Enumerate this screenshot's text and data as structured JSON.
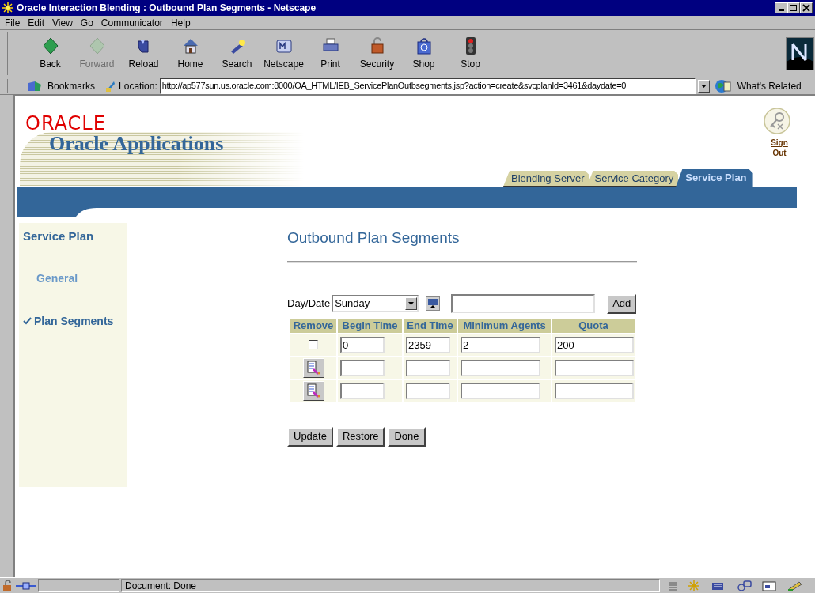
{
  "window": {
    "title": "Oracle Interaction Blending : Outbound Plan Segments - Netscape"
  },
  "menu": [
    "File",
    "Edit",
    "View",
    "Go",
    "Communicator",
    "Help"
  ],
  "toolbar": [
    {
      "label": "Back",
      "kind": "back",
      "disabled": false
    },
    {
      "label": "Forward",
      "kind": "forward",
      "disabled": true
    },
    {
      "label": "Reload",
      "kind": "reload",
      "disabled": false
    },
    {
      "label": "Home",
      "kind": "home",
      "disabled": false
    },
    {
      "label": "Search",
      "kind": "search",
      "disabled": false
    },
    {
      "label": "Netscape",
      "kind": "netscape",
      "disabled": false
    },
    {
      "label": "Print",
      "kind": "print",
      "disabled": false
    },
    {
      "label": "Security",
      "kind": "security",
      "disabled": false
    },
    {
      "label": "Shop",
      "kind": "shop",
      "disabled": false
    },
    {
      "label": "Stop",
      "kind": "stop",
      "disabled": false
    }
  ],
  "location_bar": {
    "bookmarks": "Bookmarks",
    "location_label": "Location:",
    "url": "http://ap577sun.us.oracle.com:8000/OA_HTML/IEB_ServicePlanOutbsegments.jsp?action=create&svcplanId=3461&daydate=0",
    "whats_related": "What's Related"
  },
  "header": {
    "logo": "ORACLE",
    "app_title": "Oracle Applications",
    "sign_out": "Sign Out"
  },
  "tabs": [
    {
      "label": "Blending Server",
      "selected": false
    },
    {
      "label": "Service Category",
      "selected": false
    },
    {
      "label": "Service Plan",
      "selected": true
    }
  ],
  "sidebar": {
    "heading": "Service Plan",
    "items": [
      {
        "label": "General",
        "selected": false
      },
      {
        "label": "Plan Segments",
        "selected": true
      }
    ]
  },
  "content": {
    "heading": "Outbound Plan Segments",
    "day_date_label": "Day/Date",
    "day_select": "Sunday",
    "add_button": "Add",
    "columns": [
      "Remove",
      "Begin Time",
      "End Time",
      "Minimum Agents",
      "Quota"
    ],
    "rows": [
      {
        "kind": "existing",
        "checked": false,
        "cells": [
          "0",
          "2359",
          "2",
          "200"
        ]
      },
      {
        "kind": "new"
      },
      {
        "kind": "new"
      }
    ],
    "buttons": [
      "Update",
      "Restore",
      "Done"
    ]
  },
  "status_bar": {
    "text": "Document: Done"
  }
}
